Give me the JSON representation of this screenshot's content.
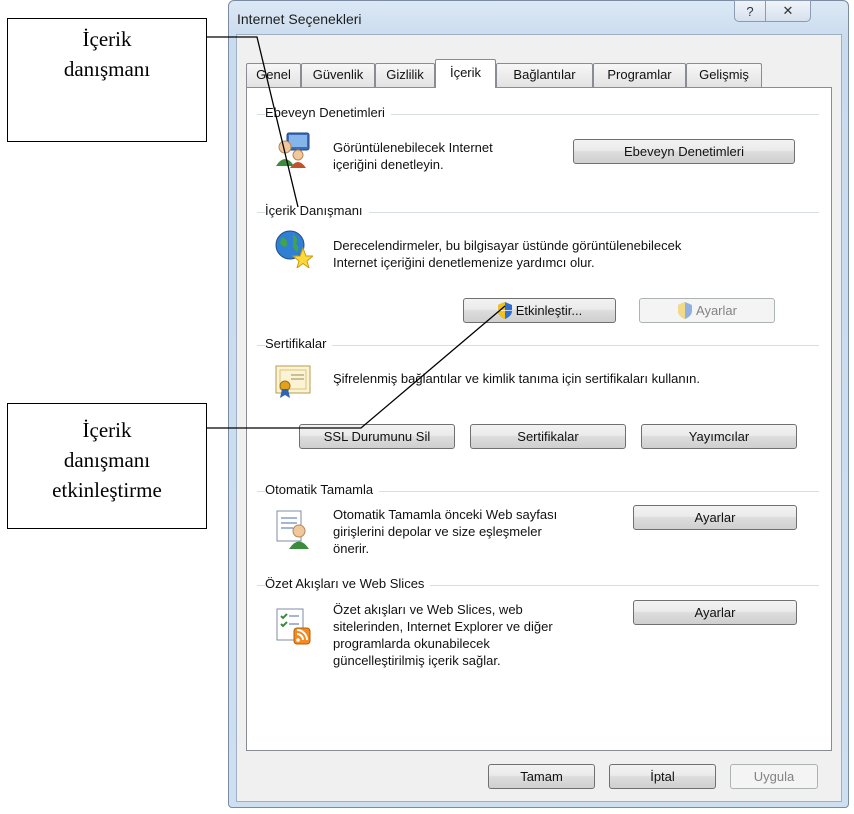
{
  "callouts": {
    "content_advisor": [
      "İçerik",
      "danışmanı"
    ],
    "enable_content_advisor": [
      "İçerik",
      "danışmanı",
      "etkinleştirme"
    ]
  },
  "window": {
    "title": "Internet Seçenekleri",
    "help_icon": "?",
    "close_icon": "✕"
  },
  "tabs": [
    "Genel",
    "Güvenlik",
    "Gizlilik",
    "İçerik",
    "Bağlantılar",
    "Programlar",
    "Gelişmiş"
  ],
  "active_tab": "İçerik",
  "sections": {
    "parental": {
      "label": "Ebeveyn Denetimleri",
      "desc": [
        "Görüntülenebilecek Internet",
        "içeriğini denetleyin."
      ],
      "button": "Ebeveyn Denetimleri",
      "icon": "parental-controls-icon"
    },
    "advisor": {
      "label": "İçerik Danışmanı",
      "desc": [
        "Derecelendirmeler, bu bilgisayar üstünde görüntülenebilecek",
        "Internet içeriğini denetlemenize yardımcı olur."
      ],
      "enable_button": "Etkinleştir...",
      "settings_button": "Ayarlar",
      "icon": "globe-star-icon"
    },
    "certificates": {
      "label": "Sertifikalar",
      "desc": "Şifrelenmiş bağlantılar ve kimlik tanıma için sertifikaları kullanın.",
      "ssl_button": "SSL Durumunu Sil",
      "certs_button": "Sertifikalar",
      "publishers_button": "Yayımcılar",
      "icon": "certificate-icon"
    },
    "autocomplete": {
      "label": "Otomatik Tamamla",
      "desc": [
        "Otomatik Tamamla önceki Web sayfası",
        "girişlerini depolar ve size eşleşmeler",
        "önerir."
      ],
      "button": "Ayarlar",
      "icon": "autocomplete-icon"
    },
    "feeds": {
      "label": "Özet Akışları ve Web Slices",
      "desc": [
        "Özet akışları ve Web Slices, web",
        "sitelerinden, Internet Explorer ve diğer",
        "programlarda okunabilecek",
        "güncelleştirilmiş içerik sağlar."
      ],
      "button": "Ayarlar",
      "icon": "rss-feed-icon"
    }
  },
  "footer": {
    "ok": "Tamam",
    "cancel": "İptal",
    "apply": "Uygula"
  },
  "colors": {
    "window_border": "#7b8ba1",
    "window_frame": "#cddff1",
    "shield_blue": "#2f6fd0",
    "shield_yellow": "#f2c21a"
  }
}
